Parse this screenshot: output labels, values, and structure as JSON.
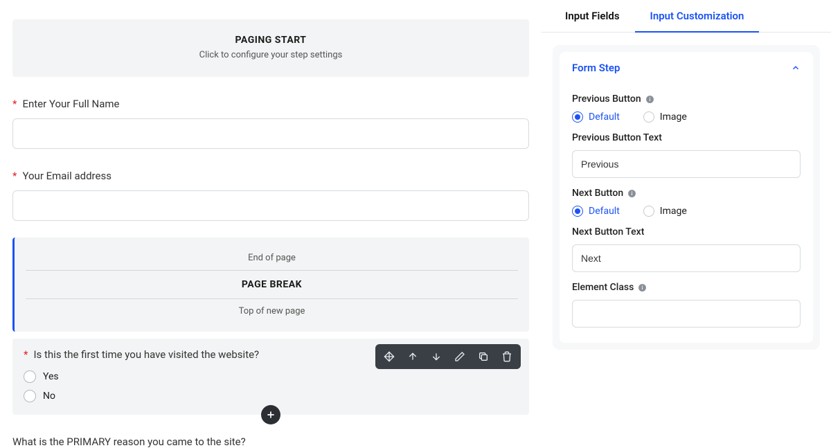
{
  "canvas": {
    "paging_start": {
      "title": "PAGING START",
      "hint": "Click to configure your step settings"
    },
    "fields": {
      "full_name_label": "Enter Your Full Name",
      "email_label": "Your Email address"
    },
    "page_break": {
      "end": "End of page",
      "title": "PAGE BREAK",
      "top": "Top of new page"
    },
    "selected_field": {
      "label": "Is this the first time you have visited the website?",
      "options": [
        "Yes",
        "No"
      ]
    },
    "next_question": "What is the PRIMARY reason you came to the site?"
  },
  "sidebar": {
    "tabs": {
      "input_fields": "Input Fields",
      "input_customization": "Input Customization"
    },
    "form_step": {
      "title": "Form Step",
      "prev_button_label": "Previous Button",
      "next_button_label": "Next Button",
      "radio_default": "Default",
      "radio_image": "Image",
      "prev_text_label": "Previous Button Text",
      "prev_text_value": "Previous",
      "next_text_label": "Next Button Text",
      "next_text_value": "Next",
      "element_class_label": "Element Class",
      "element_class_value": ""
    }
  }
}
